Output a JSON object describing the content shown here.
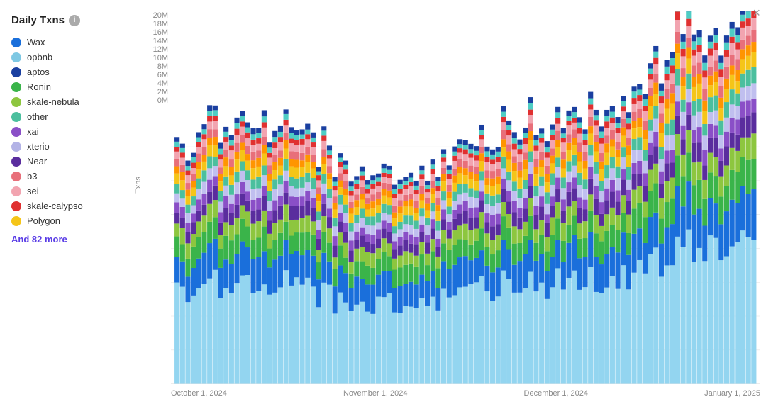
{
  "title": "Daily Txns",
  "close_label": "×",
  "legend": {
    "items": [
      {
        "label": "Wax",
        "color": "#1a6fdb"
      },
      {
        "label": "opbnb",
        "color": "#7ec8e3"
      },
      {
        "label": "aptos",
        "color": "#1a3fa0"
      },
      {
        "label": "Ronin",
        "color": "#3ab44a"
      },
      {
        "label": "skale-nebula",
        "color": "#8dc63f"
      },
      {
        "label": "other",
        "color": "#4bbf9e"
      },
      {
        "label": "xai",
        "color": "#8a4fc7"
      },
      {
        "label": "xterio",
        "color": "#b3b3e6"
      },
      {
        "label": "Near",
        "color": "#5a2d9e"
      },
      {
        "label": "b3",
        "color": "#e86f7a"
      },
      {
        "label": "sei",
        "color": "#f2a4b0"
      },
      {
        "label": "skale-calypso",
        "color": "#e03030"
      },
      {
        "label": "Polygon",
        "color": "#f5c518"
      }
    ],
    "more_text": "And 82 more"
  },
  "y_axis": {
    "title": "Txns",
    "labels": [
      "20M",
      "18M",
      "16M",
      "14M",
      "12M",
      "10M",
      "8M",
      "6M",
      "4M",
      "2M",
      "0M"
    ]
  },
  "x_axis": {
    "labels": [
      "October 1, 2024",
      "November 1, 2024",
      "December 1, 2024",
      "January 1, 2025"
    ]
  },
  "colors": {
    "wax": "#1a6fdb",
    "opbnb": "#93d5f0",
    "aptos": "#1a3fa0",
    "ronin": "#3ab44a",
    "skale_nebula": "#8dc63f",
    "other": "#4bbf9e",
    "xai": "#8a4fc7",
    "xterio": "#c0bfef",
    "near": "#5a2d9e",
    "b3": "#e86f7a",
    "sei": "#f2a4b0",
    "skale_calypso": "#e03030",
    "polygon": "#f5c518",
    "extra1": "#ff9500",
    "extra2": "#ff6b6b",
    "extra3": "#4ecdc4"
  }
}
